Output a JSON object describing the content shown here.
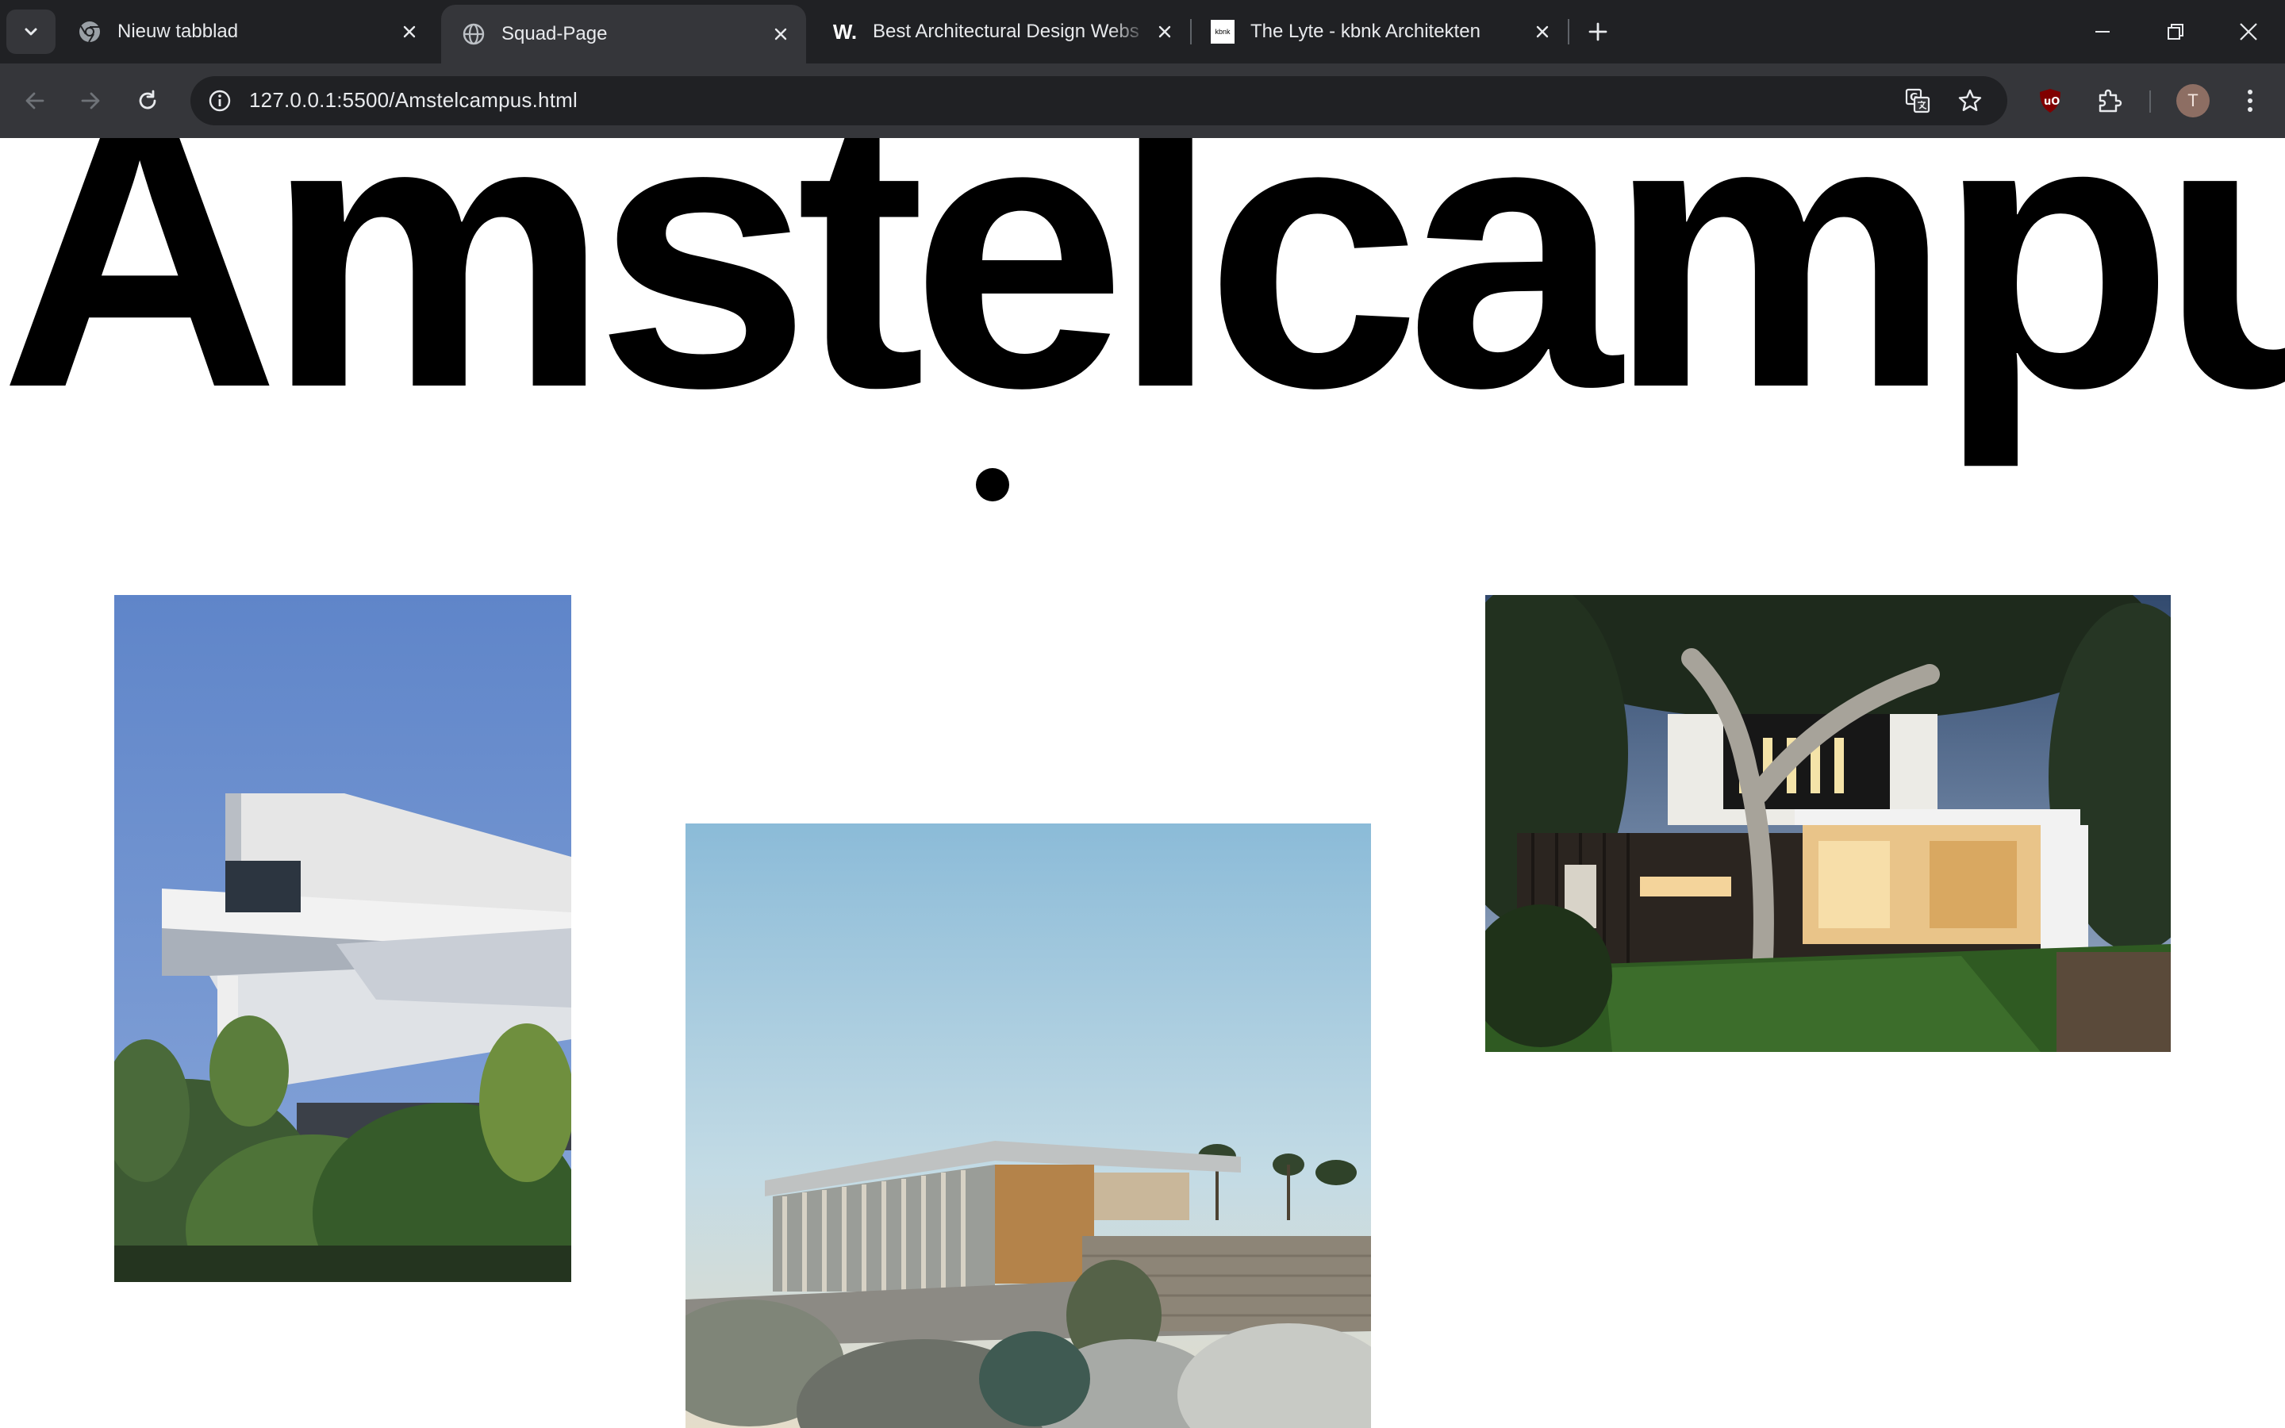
{
  "browser": {
    "tabs": [
      {
        "title": "Nieuw tabblad",
        "favicon": "chrome-icon",
        "active": false
      },
      {
        "title": "Squad-Page",
        "favicon": "globe-icon",
        "active": true
      },
      {
        "title": "Best Architectural Design Webs",
        "favicon": "w-logo-icon",
        "favicon_text": "W.",
        "active": false
      },
      {
        "title": "The Lyte - kbnk Architekten",
        "favicon": "kbnk-logo-icon",
        "favicon_text": "kbnk",
        "active": false
      }
    ],
    "url": "127.0.0.1:5500/Amstelcampus.html",
    "profile_initial": "T",
    "extension_label": "uO",
    "colors": {
      "frame": "#202124",
      "toolbar": "#35363a",
      "text": "#e8eaed",
      "ublock": "#800000"
    }
  },
  "page": {
    "heading": "Amstelcampus",
    "images": [
      {
        "name": "white-modern-villa-photo",
        "description_icon": "photo"
      },
      {
        "name": "desert-modern-house-photo",
        "description_icon": "photo"
      },
      {
        "name": "dark-wood-house-dusk-photo",
        "description_icon": "photo"
      }
    ]
  }
}
